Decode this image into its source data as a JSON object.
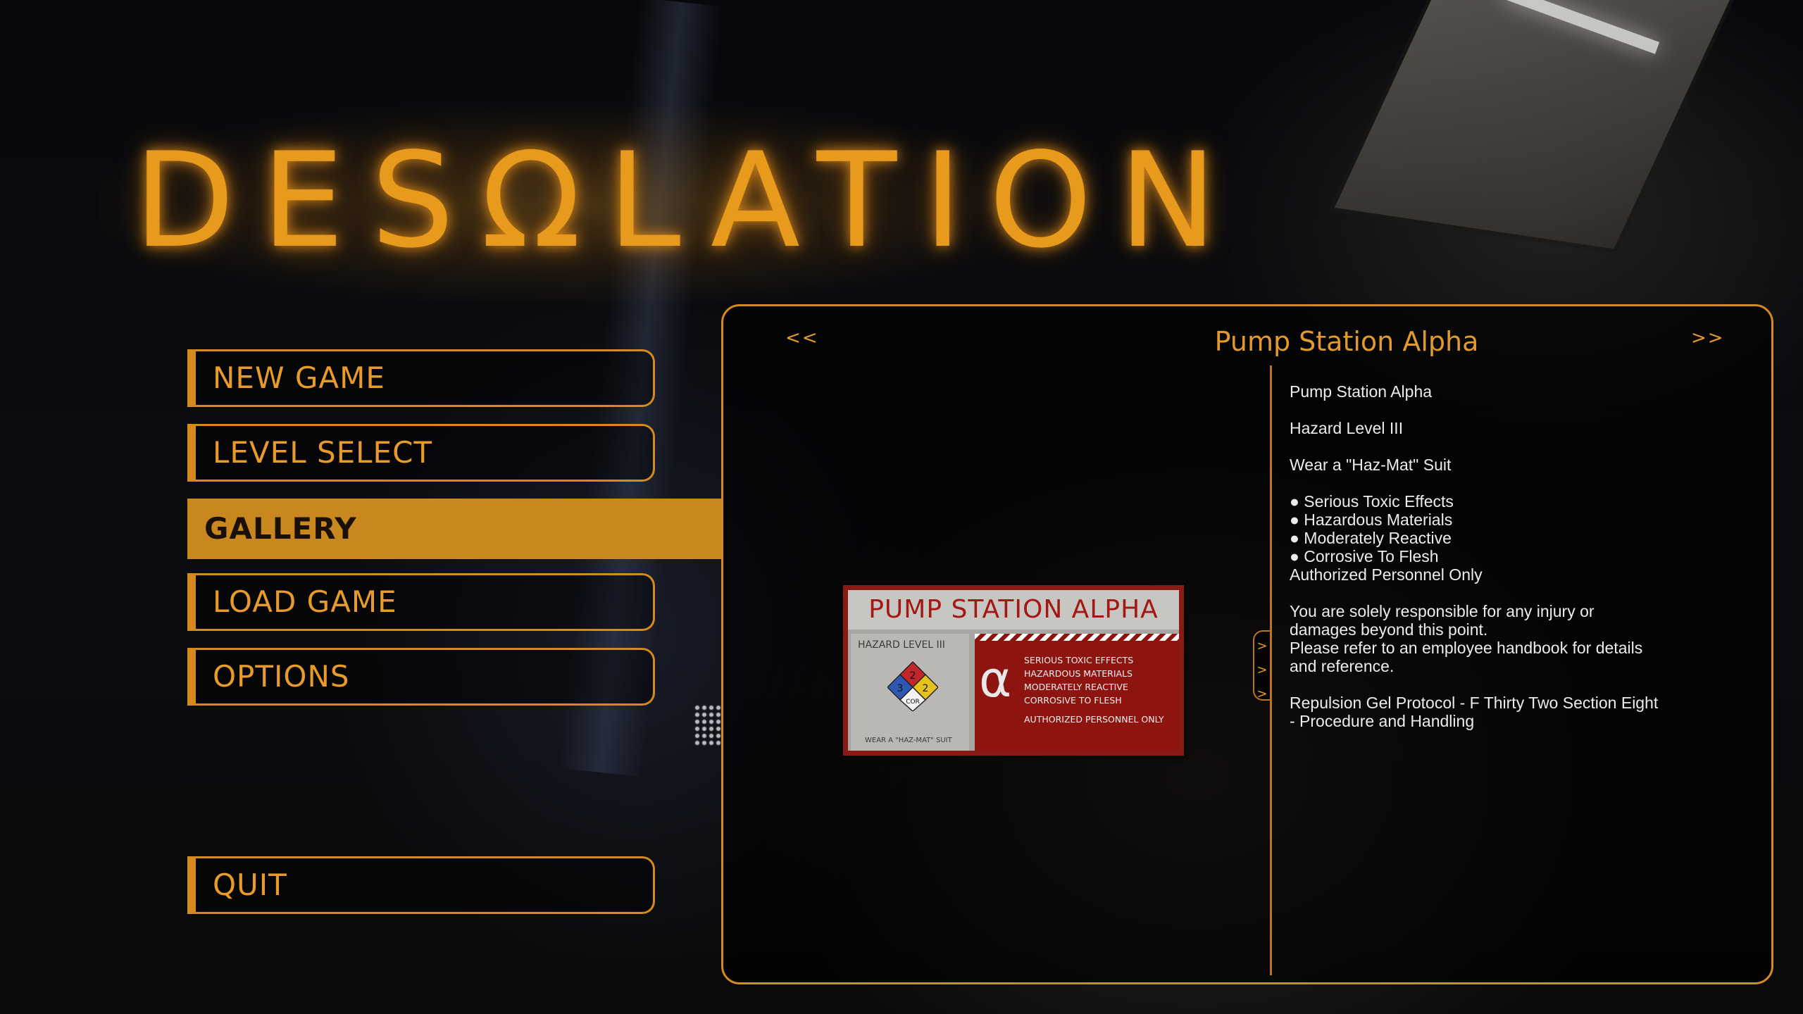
{
  "logo": {
    "text": "DESΩLATION"
  },
  "menu": {
    "items": [
      {
        "label": "NEW GAME"
      },
      {
        "label": "LEVEL SELECT"
      },
      {
        "label": "GALLERY"
      },
      {
        "label": "LOAD GAME"
      },
      {
        "label": "OPTIONS"
      },
      {
        "label": "QUIT"
      }
    ],
    "active": "GALLERY"
  },
  "gallery": {
    "title": "Pump Station Alpha",
    "prev_label": "<<",
    "next_label": ">>",
    "collapse_label": ">",
    "image": {
      "sign_title": "PUMP STATION ALPHA",
      "hazard_level": "HAZARD LEVEL III",
      "diamond_values": [
        "2",
        "3",
        "2",
        "COR"
      ],
      "suit_text": "WEAR A \"HAZ-MAT\" SUIT",
      "alpha_symbol": "α",
      "warnings": [
        "SERIOUS TOXIC EFFECTS",
        "HAZARDOUS MATERIALS",
        "MODERATELY REACTIVE",
        "CORROSIVE TO FLESH"
      ],
      "authorized": "AUTHORIZED PERSONNEL ONLY"
    },
    "description": {
      "line1": "Pump Station Alpha",
      "line2": "Hazard Level III",
      "line3": "Wear a \"Haz-Mat\" Suit",
      "bullets": [
        "● Serious Toxic Effects",
        "● Hazardous Materials",
        "● Moderately Reactive",
        "● Corrosive To Flesh"
      ],
      "authorized": "Authorized Personnel Only",
      "para1_line1": "You are solely responsible for any injury or",
      "para1_line2": "damages beyond this point.",
      "para1_line3": "Please refer to an employee handbook for details",
      "para1_line4": "and reference.",
      "para2_line1": "Repulsion Gel Protocol - F Thirty Two Section Eight",
      "para2_line2": "- Procedure and Handling"
    }
  },
  "colors": {
    "accent": "#d48a1f",
    "accent_text": "#e39a2c",
    "active_bg": "#c98720",
    "sign_red": "#8e1410"
  }
}
